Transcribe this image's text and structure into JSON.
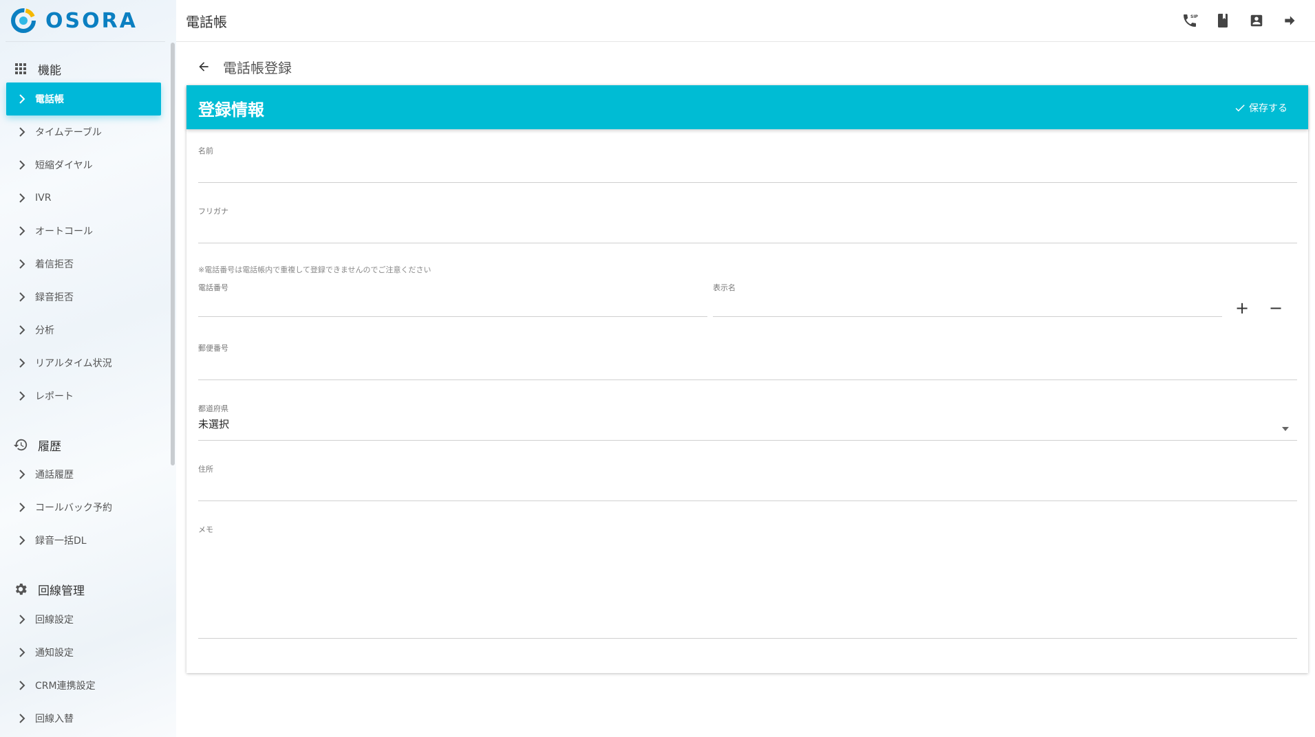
{
  "app": {
    "logo_text": "OSORA"
  },
  "header": {
    "title": "電話帳",
    "icons": [
      "sip-phone-icon",
      "book-icon",
      "account-box-icon",
      "logout-icon"
    ]
  },
  "sidebar": {
    "sections": [
      {
        "title": "機能",
        "icon": "apps-grid-icon",
        "items": [
          "電話帳",
          "タイムテーブル",
          "短縮ダイヤル",
          "IVR",
          "オートコール",
          "着信拒否",
          "録音拒否",
          "分析",
          "リアルタイム状況",
          "レポート"
        ]
      },
      {
        "title": "履歴",
        "icon": "history-icon",
        "items": [
          "通話履歴",
          "コールバック予約",
          "録音一括DL"
        ]
      },
      {
        "title": "回線管理",
        "icon": "gear-icon",
        "items": [
          "回線設定",
          "通知設定",
          "CRM連携設定",
          "回線入替"
        ]
      }
    ],
    "active_item": "電話帳"
  },
  "page": {
    "title": "電話帳登録",
    "card_title": "登録情報",
    "save_label": "保存する",
    "accent": "#00bcd4"
  },
  "form": {
    "name_label": "名前",
    "name_value": "",
    "kana_label": "フリガナ",
    "kana_value": "",
    "phone_note": "※電話番号は電話帳内で重複して登録できませんのでご注意ください",
    "phone_label": "電話番号",
    "phone_value": "",
    "display_name_label": "表示名",
    "display_name_value": "",
    "add_symbol": "+",
    "remove_symbol": "−",
    "postal_label": "郵便番号",
    "postal_value": "",
    "prefecture_label": "都道府県",
    "prefecture_value": "未選択",
    "address_label": "住所",
    "address_value": "",
    "memo_label": "メモ",
    "memo_value": ""
  }
}
